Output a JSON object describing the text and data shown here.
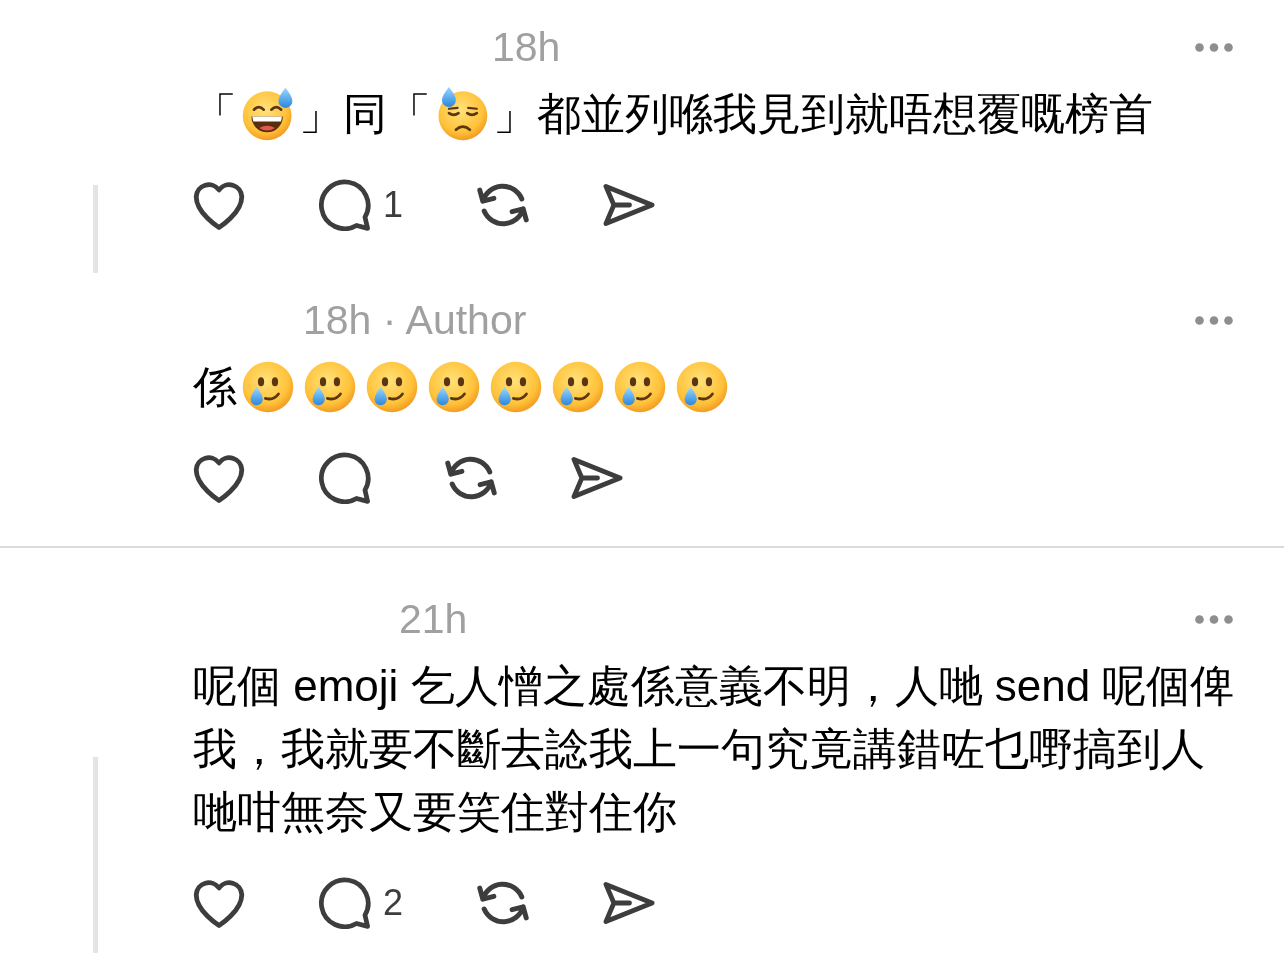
{
  "threads": [
    {
      "comments": [
        {
          "meta": "18h",
          "thread_line": true,
          "body": [
            {
              "kind": "text",
              "text": "「"
            },
            {
              "kind": "grin_sweat"
            },
            {
              "kind": "text",
              "text": "」同「"
            },
            {
              "kind": "downcast_sweat"
            },
            {
              "kind": "text",
              "text": "」都並列喺我見到就唔想覆嘅榜首"
            }
          ],
          "actions": [
            {
              "kind": "like"
            },
            {
              "kind": "reply",
              "count": "1"
            },
            {
              "kind": "repost"
            },
            {
              "kind": "share"
            }
          ]
        },
        {
          "meta": "18h · Author",
          "thread_line": false,
          "body": [
            {
              "kind": "text",
              "text": "係"
            },
            {
              "kind": "smile_tear"
            },
            {
              "kind": "smile_tear"
            },
            {
              "kind": "smile_tear"
            },
            {
              "kind": "smile_tear"
            },
            {
              "kind": "smile_tear"
            },
            {
              "kind": "smile_tear"
            },
            {
              "kind": "smile_tear"
            },
            {
              "kind": "smile_tear"
            }
          ],
          "actions": [
            {
              "kind": "like"
            },
            {
              "kind": "reply"
            },
            {
              "kind": "repost"
            },
            {
              "kind": "share"
            }
          ]
        }
      ]
    },
    {
      "comments": [
        {
          "meta": "21h",
          "thread_line": true,
          "body": [
            {
              "kind": "text",
              "text": "呢個 emoji 乞人憎之處係意義不明，人哋 send 呢個俾我，我就要不斷去諗我上一句究竟講錯咗乜嘢搞到人哋咁無奈又要笑住對住你"
            }
          ],
          "actions": [
            {
              "kind": "like"
            },
            {
              "kind": "reply",
              "count": "2"
            },
            {
              "kind": "repost"
            },
            {
              "kind": "share"
            }
          ]
        }
      ]
    }
  ]
}
